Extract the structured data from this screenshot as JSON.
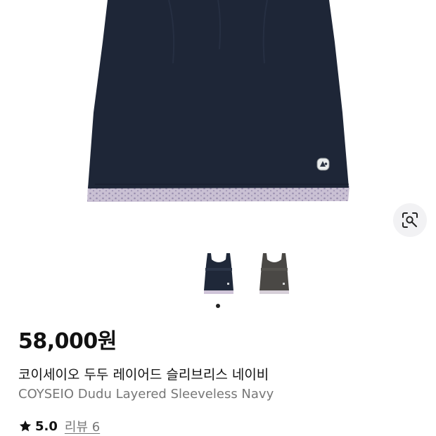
{
  "product": {
    "price": "58,000원",
    "name_ko": "코이세이오 두두 레이어드 슬리브리스 네이비",
    "name_en": "COYSEIO Dudu Layered Sleeveless Navy",
    "rating": "5.0",
    "review_label": "리뷰 6"
  },
  "gallery": {
    "thumbnails": [
      "navy",
      "charcoal"
    ],
    "selected_index": 0
  },
  "icons": {
    "lens": "lens-search-icon",
    "star": "star-icon"
  },
  "colors": {
    "navy": "#1e2637",
    "charcoal": "#4a4845",
    "lavender": "#c6bdd0"
  }
}
